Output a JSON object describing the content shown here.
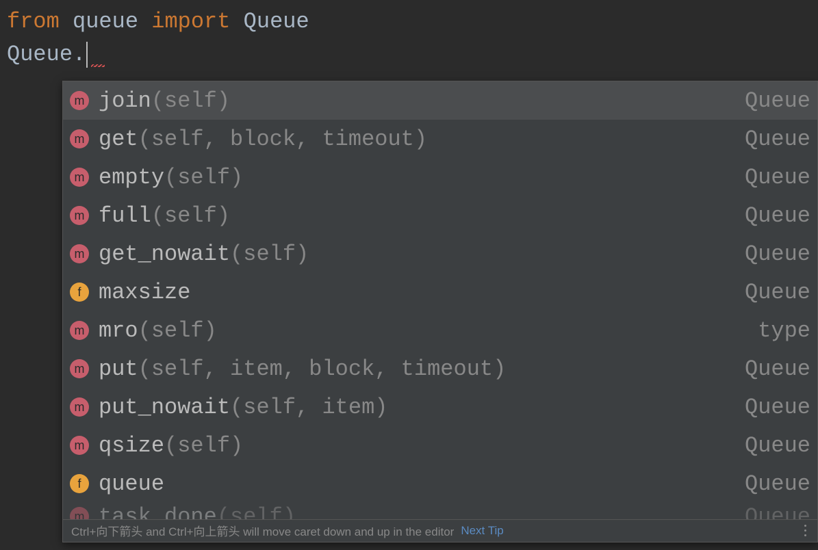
{
  "code": {
    "line1": {
      "kw_from": "from",
      "module": "queue",
      "kw_import": "import",
      "name": "Queue"
    },
    "line2": {
      "text": "Queue."
    }
  },
  "completion": {
    "items": [
      {
        "icon": "m",
        "name": "join",
        "params": "(self)",
        "origin": "Queue",
        "selected": true
      },
      {
        "icon": "m",
        "name": "get",
        "params": "(self, block, timeout)",
        "origin": "Queue",
        "selected": false
      },
      {
        "icon": "m",
        "name": "empty",
        "params": "(self)",
        "origin": "Queue",
        "selected": false
      },
      {
        "icon": "m",
        "name": "full",
        "params": "(self)",
        "origin": "Queue",
        "selected": false
      },
      {
        "icon": "m",
        "name": "get_nowait",
        "params": "(self)",
        "origin": "Queue",
        "selected": false
      },
      {
        "icon": "f",
        "name": "maxsize",
        "params": "",
        "origin": "Queue",
        "selected": false
      },
      {
        "icon": "m",
        "name": "mro",
        "params": "(self)",
        "origin": "type",
        "selected": false
      },
      {
        "icon": "m",
        "name": "put",
        "params": "(self, item, block, timeout)",
        "origin": "Queue",
        "selected": false
      },
      {
        "icon": "m",
        "name": "put_nowait",
        "params": "(self, item)",
        "origin": "Queue",
        "selected": false
      },
      {
        "icon": "m",
        "name": "qsize",
        "params": "(self)",
        "origin": "Queue",
        "selected": false
      },
      {
        "icon": "f",
        "name": "queue",
        "params": "",
        "origin": "Queue",
        "selected": false
      },
      {
        "icon": "m",
        "name": "task_done",
        "params": "(self)",
        "origin": "Queue",
        "selected": false,
        "partial": true
      }
    ],
    "hint": {
      "text": "Ctrl+向下箭头 and Ctrl+向上箭头 will move caret down and up in the editor",
      "link": "Next Tip"
    }
  }
}
